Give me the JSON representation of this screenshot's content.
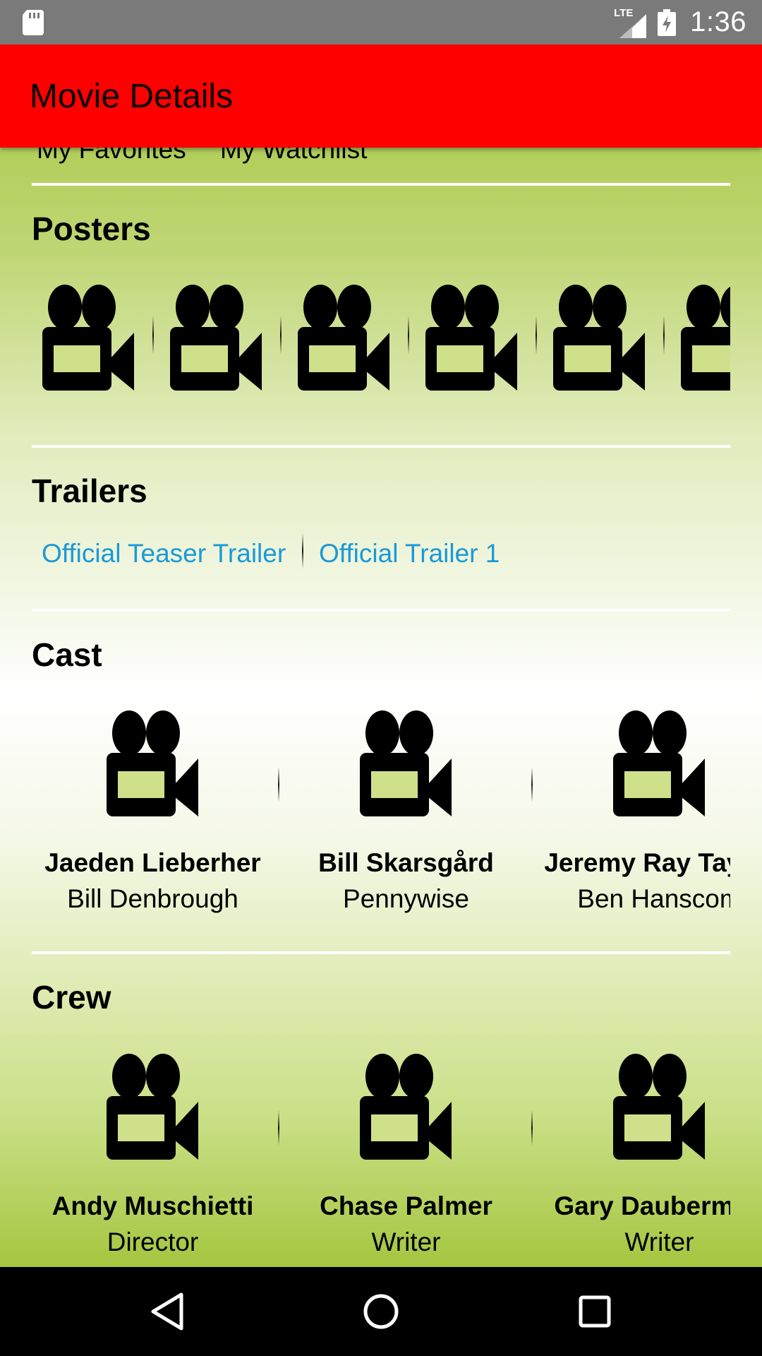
{
  "status_bar": {
    "time": "1:36",
    "network": "LTE",
    "icons": [
      "sd-card-icon",
      "signal-icon",
      "battery-charging-icon"
    ]
  },
  "app_bar": {
    "title": "Movie Details",
    "color": "#ff0000"
  },
  "lists": {
    "favorites_label": "My Favorites",
    "watchlist_label": "My Watchlist"
  },
  "posters": {
    "title": "Posters",
    "items": [
      "video-camera-icon",
      "video-camera-icon",
      "video-camera-icon",
      "video-camera-icon",
      "video-camera-icon",
      "video-camera-icon"
    ]
  },
  "trailers": {
    "title": "Trailers",
    "items": [
      {
        "label": "Official Teaser Trailer"
      },
      {
        "label": "Official Trailer 1"
      }
    ],
    "link_color": "#1a9ad6"
  },
  "cast": {
    "title": "Cast",
    "items": [
      {
        "name": "Jaeden Lieberher",
        "role": "Bill Denbrough"
      },
      {
        "name": "Bill Skarsgård",
        "role": "Pennywise"
      },
      {
        "name": "Jeremy Ray Taylor",
        "role": "Ben Hanscom"
      }
    ]
  },
  "crew": {
    "title": "Crew",
    "items": [
      {
        "name": "Andy Muschietti",
        "role": "Director"
      },
      {
        "name": "Chase Palmer",
        "role": "Writer"
      },
      {
        "name": "Gary Dauberman",
        "role": "Writer"
      }
    ]
  },
  "nav_bar": {
    "buttons": [
      "back-icon",
      "home-icon",
      "recents-icon"
    ]
  }
}
